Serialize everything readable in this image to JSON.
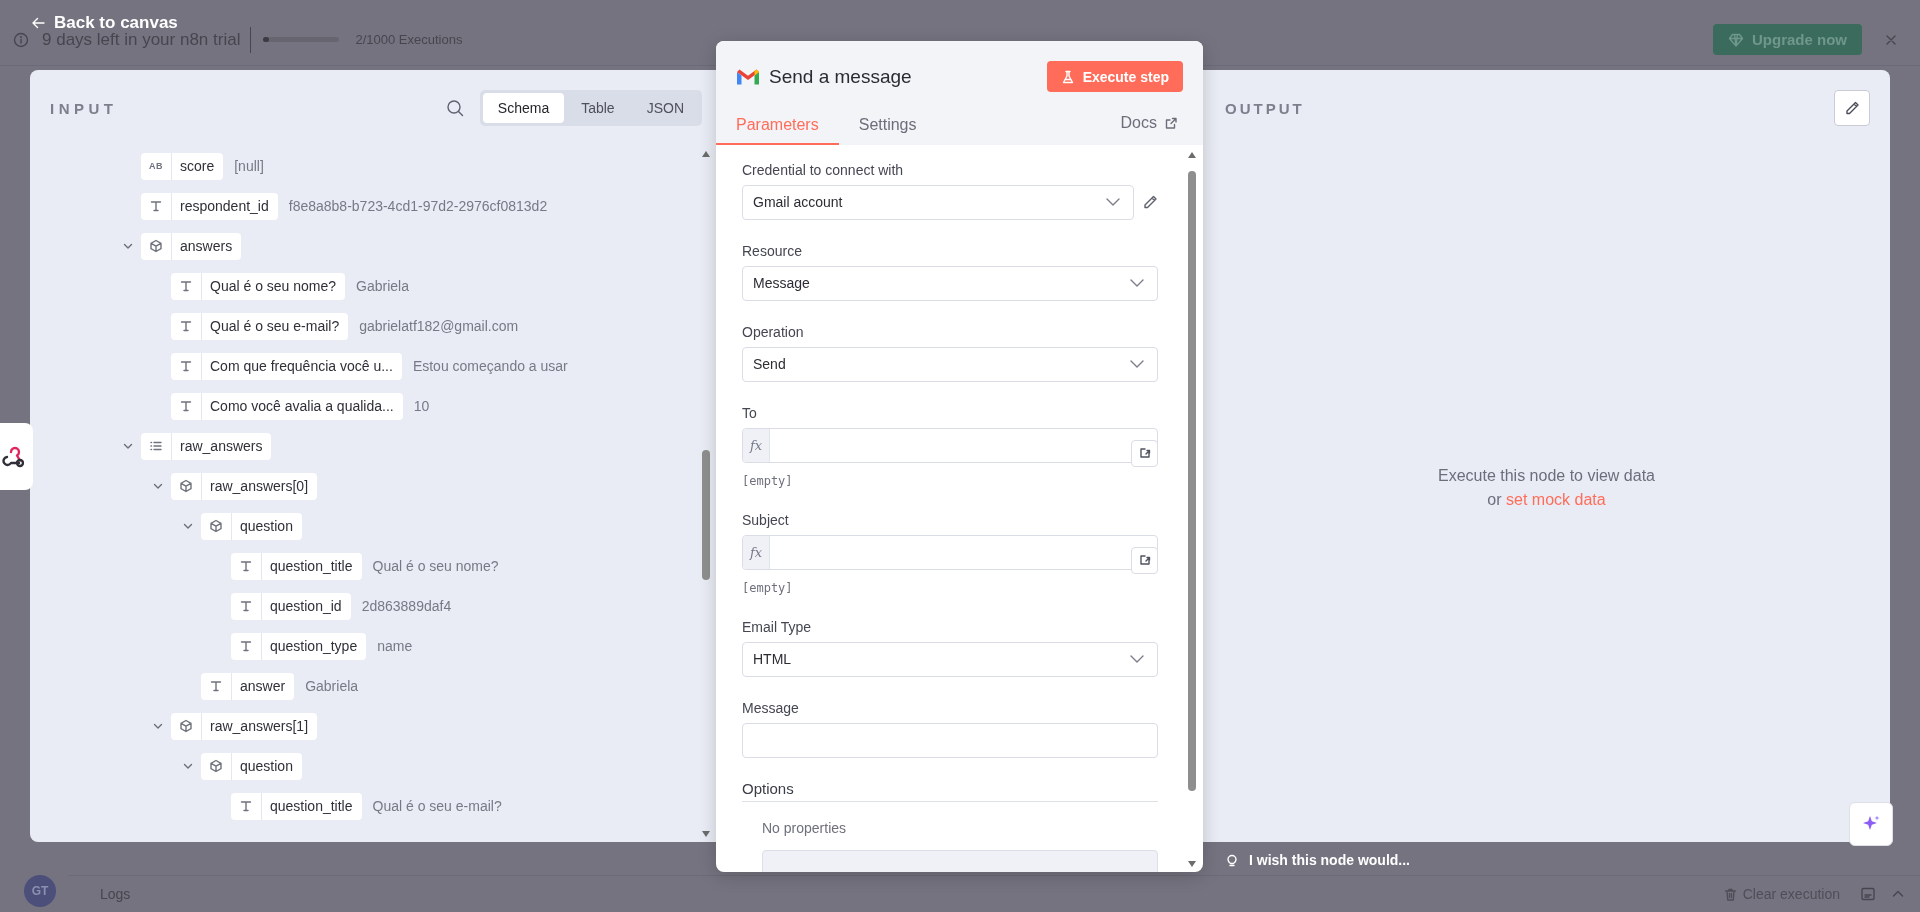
{
  "back_label": "Back to canvas",
  "trial": {
    "text": "9 days left in your n8n trial",
    "level": 0.002,
    "executions": "2/1000 Executions",
    "upgrade_button": "Upgrade now"
  },
  "input": {
    "title": "INPUT",
    "views": [
      {
        "label": "Schema",
        "selected": true
      },
      {
        "label": "Table",
        "selected": false
      },
      {
        "label": "JSON",
        "selected": false
      }
    ],
    "schema": [
      {
        "kind": "null",
        "type_label": "AB",
        "key": "score",
        "value": "[null]"
      },
      {
        "kind": "string",
        "key": "respondent_id",
        "value": "f8e8a8b8-b723-4cd1-97d2-2976cf0813d2"
      },
      {
        "kind": "object",
        "key": "answers",
        "expanded": true,
        "children": [
          {
            "kind": "string",
            "key": "Qual é o seu nome?",
            "value": "Gabriela"
          },
          {
            "kind": "string",
            "key": "Qual é o seu e-mail?",
            "value": "gabrielatf182@gmail.com"
          },
          {
            "kind": "string",
            "key": "Com que frequência você u...",
            "value": "Estou começando a usar"
          },
          {
            "kind": "string",
            "key": "Como você avalia a qualida...",
            "value": "10"
          }
        ]
      },
      {
        "kind": "array",
        "key": "raw_answers",
        "expanded": true,
        "children": [
          {
            "kind": "object",
            "key": "raw_answers[0]",
            "expanded": true,
            "children": [
              {
                "kind": "object",
                "key": "question",
                "expanded": true,
                "children": [
                  {
                    "kind": "string",
                    "key": "question_title",
                    "value": "Qual é o seu nome?"
                  },
                  {
                    "kind": "string",
                    "key": "question_id",
                    "value": "2d863889daf4"
                  },
                  {
                    "kind": "string",
                    "key": "question_type",
                    "value": "name"
                  }
                ]
              },
              {
                "kind": "string",
                "key": "answer",
                "value": "Gabriela"
              }
            ]
          },
          {
            "kind": "object",
            "key": "raw_answers[1]",
            "expanded": true,
            "children": [
              {
                "kind": "object",
                "key": "question",
                "expanded": true,
                "children": [
                  {
                    "kind": "string",
                    "key": "question_title",
                    "value": "Qual é o seu e-mail?"
                  }
                ]
              }
            ]
          }
        ]
      }
    ]
  },
  "node": {
    "title": "Send a message",
    "execute_button": "Execute step",
    "tabs": [
      {
        "label": "Parameters",
        "selected": true
      },
      {
        "label": "Settings",
        "selected": false
      }
    ],
    "docs_link": "Docs",
    "fields": [
      {
        "kind": "credential",
        "label": "Credential to connect with",
        "value": "Gmail account"
      },
      {
        "kind": "select",
        "label": "Resource",
        "value": "Message"
      },
      {
        "kind": "select",
        "label": "Operation",
        "value": "Send"
      },
      {
        "kind": "expression",
        "label": "To",
        "prefix": "fx",
        "hint": "[empty]"
      },
      {
        "kind": "expression",
        "label": "Subject",
        "prefix": "fx",
        "hint": "[empty]"
      },
      {
        "kind": "select",
        "label": "Email Type",
        "value": "HTML"
      },
      {
        "kind": "text",
        "label": "Message"
      }
    ],
    "options": {
      "title": "Options",
      "empty_text": "No properties"
    }
  },
  "output": {
    "title": "OUTPUT",
    "message": "Execute this node to view data",
    "message_or": "or",
    "mock_link": "set mock data"
  },
  "feedback_prompt": "I wish this node would...",
  "logs": {
    "avatar": "GT",
    "title": "Logs",
    "clear_button": "Clear execution"
  }
}
